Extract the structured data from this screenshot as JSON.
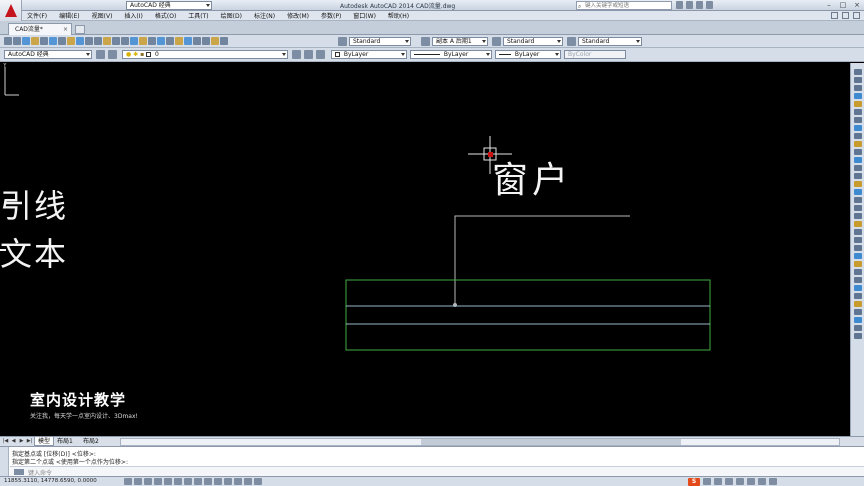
{
  "titlebar": {
    "title": "Autodesk AutoCAD 2014    CAD流量.dwg",
    "workspace": "AutoCAD 经典",
    "search_placeholder": "键入关键字或短语"
  },
  "menu": {
    "items": [
      "文件(F)",
      "编辑(E)",
      "视图(V)",
      "插入(I)",
      "格式(O)",
      "工具(T)",
      "绘图(D)",
      "标注(N)",
      "修改(M)",
      "参数(P)",
      "窗口(W)",
      "帮助(H)"
    ]
  },
  "doc_tab": {
    "label": "CAD流量*",
    "close": "×"
  },
  "toolbar1": {
    "text_style": "Standard",
    "dim_style": "副本 A 后期1",
    "table_style": "Standard",
    "mleader_style": "Standard"
  },
  "toolbar2": {
    "workspace": "AutoCAD 经典",
    "layer": "0",
    "color": "ByLayer",
    "linetype": "ByLayer",
    "lineweight": "ByLayer",
    "plotstyle": "ByColor"
  },
  "drawing": {
    "text_leader": "引线",
    "text_text": "文本",
    "text_window": "窗户",
    "accent_green": "#3fae3f",
    "leader_color": "#b8b8b8",
    "cursor_pick_color": "#cc1111"
  },
  "watermark": {
    "title": "室内设计教学",
    "subtitle": "关注我，每天学一点室内设计、3Dmax!"
  },
  "layout_tabs": [
    "模型",
    "布局1",
    "布局2"
  ],
  "command": {
    "line1": "指定基点或 [位移(D)] <位移>:",
    "line2": "指定第二个点或 <使用第一个点作为位移>:",
    "input_placeholder": "键入命令"
  },
  "status": {
    "coords": "11855.3110, 14778.6590, 0.0000"
  }
}
